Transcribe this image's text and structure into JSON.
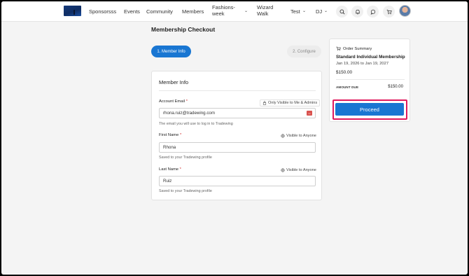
{
  "nav": {
    "items": [
      {
        "label": "Sponsorsss"
      },
      {
        "label": "Events"
      },
      {
        "label": "Community"
      },
      {
        "label": "Members"
      },
      {
        "label": "Fashions-week"
      },
      {
        "label": "Wizard Walk"
      },
      {
        "label": "Test"
      },
      {
        "label": "DJ"
      }
    ],
    "icons": [
      "search-icon",
      "bell-icon",
      "chat-icon",
      "cart-icon"
    ]
  },
  "page": {
    "title": "Membership Checkout"
  },
  "stepper": {
    "active_label": "1. Member Info",
    "inactive_label": "2. Configure"
  },
  "member_info": {
    "title": "Member Info",
    "fields": [
      {
        "label": "Account Email",
        "required_mark": "*",
        "visibility": "Only Visible to Me & Admins",
        "value": "rhona.ruiz@tradewing.com",
        "helper": "The email you will use to log in to Tradewing"
      },
      {
        "label": "First Name",
        "required_mark": "*",
        "visibility": "Visible to Anyone",
        "value": "Rhona",
        "helper": "Saved to your Tradewing profile"
      },
      {
        "label": "Last Name",
        "required_mark": "*",
        "visibility": "Visible to Anyone",
        "value": "Ruiz",
        "helper": "Saved to your Tradewing profile"
      }
    ]
  },
  "order_summary": {
    "title": "Order Summary",
    "plan": "Standard Individual Membership",
    "dates": "Jan 19, 2026 to Jan 19, 2027",
    "price": "$150.00",
    "amount_due_label": "AMOUNT DUE",
    "amount_due_value": "$150.00",
    "proceed_label": "Proceed"
  },
  "colors": {
    "accent": "#1976d2",
    "highlight": "#e0195d",
    "required": "#d32f2f"
  }
}
